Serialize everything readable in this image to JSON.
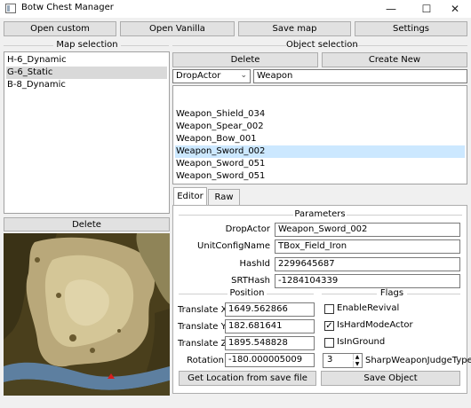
{
  "window": {
    "title": "Botw Chest Manager",
    "controls": {
      "minimize": "—",
      "maximize": "☐",
      "close": "✕"
    }
  },
  "toolbar": {
    "open_custom": "Open custom",
    "open_vanilla": "Open Vanilla",
    "save_map": "Save map",
    "settings": "Settings"
  },
  "map_selection": {
    "label": "Map selection",
    "items": [
      "H-6_Dynamic",
      "G-6_Static",
      "B-8_Dynamic"
    ],
    "selected_index": 1,
    "delete_label": "Delete"
  },
  "object_selection": {
    "label": "Object selection",
    "delete_label": "Delete",
    "create_label": "Create New",
    "filter_type": "DropActor",
    "filter_value": "Weapon",
    "items": [
      "Weapon_Shield_034",
      "Weapon_Spear_002",
      "Weapon_Bow_001",
      "Weapon_Sword_002",
      "Weapon_Sword_051",
      "Weapon_Sword_051"
    ],
    "selected_index": 3
  },
  "tabs": {
    "editor": "Editor",
    "raw": "Raw"
  },
  "parameters": {
    "label": "Parameters",
    "drop_actor_label": "DropActor",
    "drop_actor_value": "Weapon_Sword_002",
    "unit_config_label": "UnitConfigName",
    "unit_config_value": "TBox_Field_Iron",
    "hash_id_label": "HashId",
    "hash_id_value": "2299645687",
    "srt_hash_label": "SRTHash",
    "srt_hash_value": "-1284104339"
  },
  "position": {
    "label": "Position",
    "tx_label": "Translate X",
    "tx_value": "1649.562866",
    "ty_label": "Translate Y",
    "ty_value": "182.681641",
    "tz_label": "Translate Z",
    "tz_value": "1895.548828",
    "rot_label": "Rotation",
    "rot_value": "-180.000005009"
  },
  "flags": {
    "label": "Flags",
    "enable_revival": "EnableRevival",
    "is_hard_mode_actor": "IsHardModeActor",
    "is_in_ground": "IsInGround",
    "sharp_label": "SharpWeaponJudgeType",
    "sharp_value": "3",
    "checked": {
      "enable_revival": false,
      "is_hard_mode_actor": true,
      "is_in_ground": false
    }
  },
  "actions": {
    "get_location": "Get Location from save file",
    "save_object": "Save Object"
  },
  "colors": {
    "selection_blue": "#cce8ff",
    "selection_gray": "#d9d9d9",
    "marker_red": "#d81e1e"
  }
}
